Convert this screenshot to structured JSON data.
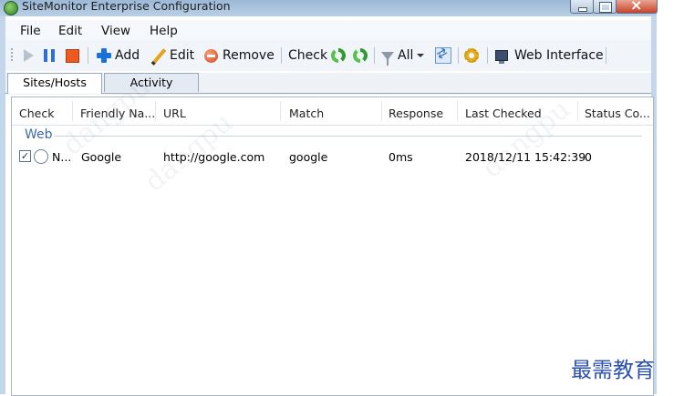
{
  "window": {
    "title": "SiteMonitor Enterprise Configuration"
  },
  "menu": [
    "File",
    "Edit",
    "View",
    "Help"
  ],
  "toolbar": {
    "add": "Add",
    "edit": "Edit",
    "remove": "Remove",
    "check": "Check",
    "filter": "All",
    "web_interface": "Web Interface"
  },
  "tabs": [
    "Sites/Hosts",
    "Activity"
  ],
  "grid": {
    "columns": [
      "Check",
      "Friendly Na...",
      "URL",
      "Match",
      "Response",
      "Last Checked",
      "Status Co..."
    ],
    "group": "Web",
    "rows": [
      {
        "checked": "✓",
        "check": "N...",
        "friendly_name": "Google",
        "url": "http://google.com",
        "match": "google",
        "response": "0ms",
        "last_checked": "2018/12/11 15:42:39",
        "status_code": "0"
      }
    ]
  },
  "watermark": "dangpu",
  "corner_text": "最需教育"
}
